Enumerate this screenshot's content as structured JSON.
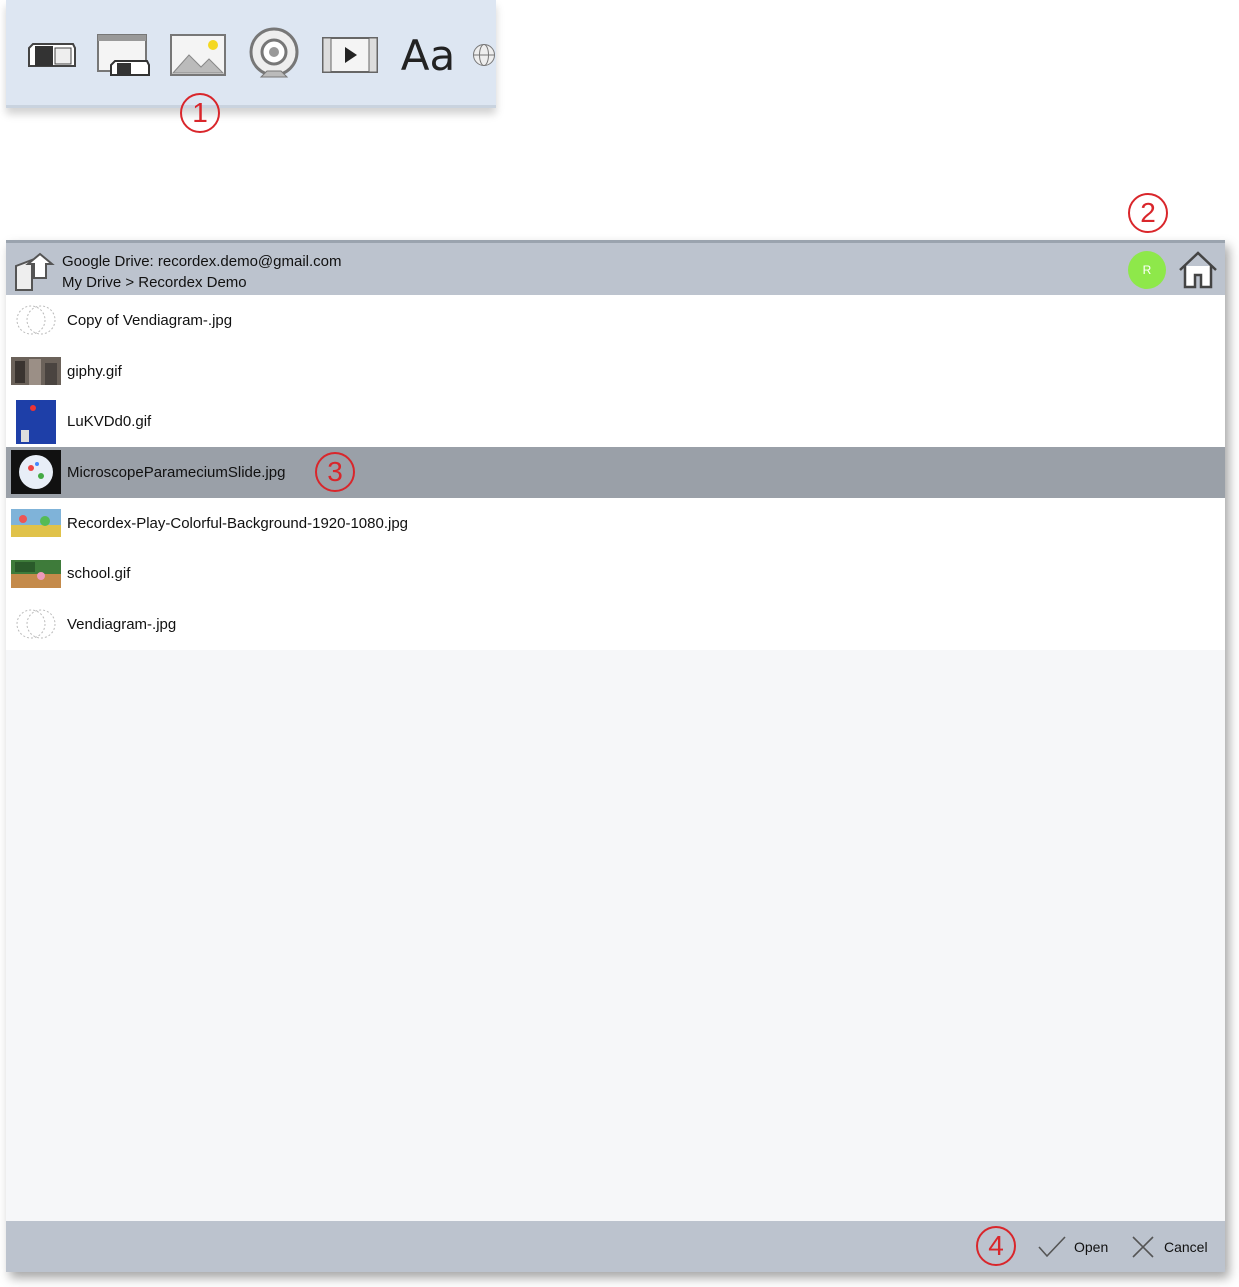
{
  "toolbar": {
    "icons": [
      "eraser-icon",
      "clear-page-icon",
      "image-icon",
      "webcam-icon",
      "video-icon",
      "text-icon",
      "globe-icon"
    ],
    "text_tool_label": "Aa"
  },
  "callouts": {
    "c1": "1",
    "c2": "2",
    "c3": "3",
    "c4": "4"
  },
  "dialog": {
    "header": {
      "account": "Google Drive: recordex.demo@gmail.com",
      "path": "My Drive > Recordex Demo",
      "avatar_letter": "R"
    },
    "files": [
      {
        "name": "Copy of Vendiagram-.jpg",
        "thumb": "venn-thumbnail",
        "selected": false
      },
      {
        "name": "giphy.gif",
        "thumb": "photo-thumbnail",
        "selected": false
      },
      {
        "name": "LuKVDd0.gif",
        "thumb": "blue-thumbnail",
        "selected": false
      },
      {
        "name": "MicroscopeParameciumSlide.jpg",
        "thumb": "microscope-thumbnail",
        "selected": true
      },
      {
        "name": "Recordex-Play-Colorful-Background-1920-1080.jpg",
        "thumb": "colorful-thumbnail",
        "selected": false
      },
      {
        "name": "school.gif",
        "thumb": "classroom-thumbnail",
        "selected": false
      },
      {
        "name": "Vendiagram-.jpg",
        "thumb": "venn-thumbnail",
        "selected": false
      }
    ],
    "footer": {
      "open_label": "Open",
      "cancel_label": "Cancel"
    }
  },
  "colors": {
    "header_bar": "#bcc3ce",
    "selected_row": "#9aa0a8",
    "avatar": "#8ee84a",
    "callout": "#d9262b"
  }
}
